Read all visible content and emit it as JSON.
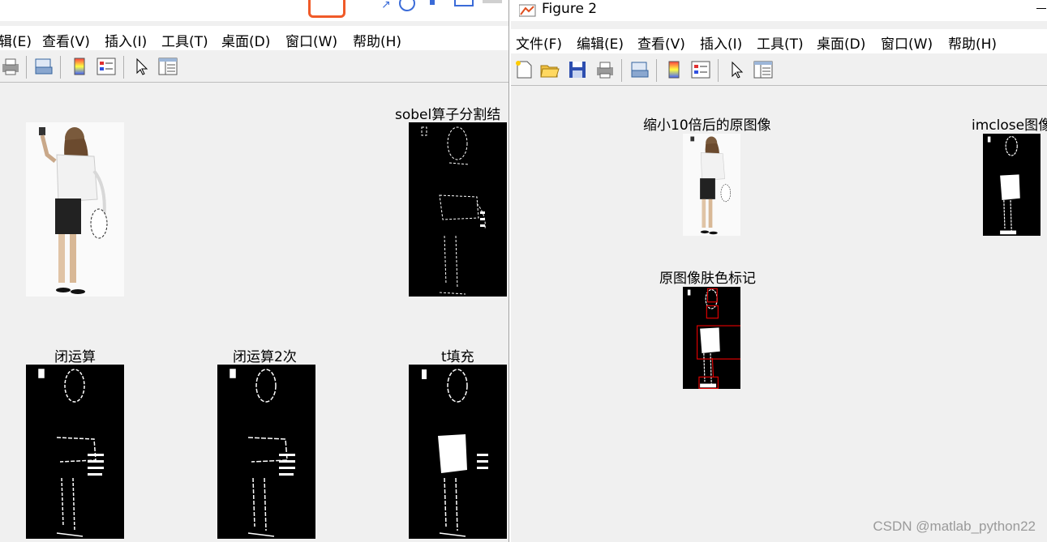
{
  "left_window": {
    "menu": [
      "辑(E)",
      "查看(V)",
      "插入(I)",
      "工具(T)",
      "桌面(D)",
      "窗口(W)",
      "帮助(H)"
    ],
    "axes_titles": {
      "sobel": "sobel算子分割结",
      "close1": "闭运算",
      "close2": "闭运算2次",
      "fill": "t填充"
    }
  },
  "right_window": {
    "title": "Figure 2",
    "menu": [
      "文件(F)",
      "编辑(E)",
      "查看(V)",
      "插入(I)",
      "工具(T)",
      "桌面(D)",
      "窗口(W)",
      "帮助(H)"
    ],
    "axes_titles": {
      "scaled": "缩小10倍后的原图像",
      "imclose": "imclose图像",
      "skin": "原图像肤色标记"
    }
  },
  "watermark": "CSDN @matlab_python22",
  "colors": {
    "window_bg": "#f0f0f0",
    "marker_red": "#e00000"
  }
}
